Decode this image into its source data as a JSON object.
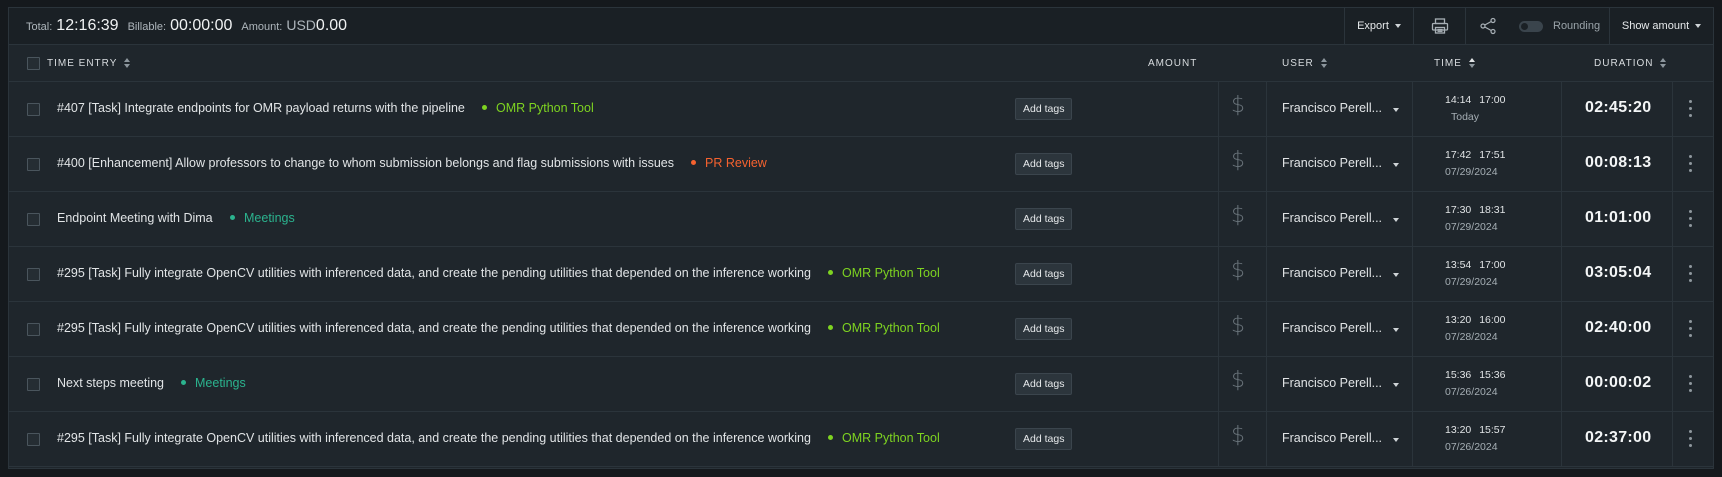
{
  "summary": {
    "total_label": "Total:",
    "total_value": "12:16:39",
    "billable_label": "Billable:",
    "billable_value": "00:00:00",
    "amount_label": "Amount:",
    "amount_currency": "USD",
    "amount_value": "0.00",
    "export_label": "Export",
    "rounding_label": "Rounding",
    "show_amount_label": "Show amount"
  },
  "columns": {
    "time_entry": "TIME ENTRY",
    "amount": "AMOUNT",
    "user": "USER",
    "time": "TIME",
    "duration": "DURATION"
  },
  "add_tags_label": "Add tags",
  "colors": {
    "omr_python_tool": "#7ed321",
    "pr_review": "#f5622f",
    "meetings": "#2bb38e"
  },
  "entries": [
    {
      "description": "#407 [Task] Integrate endpoints for OMR payload returns with the pipeline",
      "project": "OMR Python Tool",
      "project_color": "#7ed321",
      "user": "Francisco Perell...",
      "start": "14:14",
      "end": "17:00",
      "date": "Today",
      "duration": "02:45:20"
    },
    {
      "description": "#400 [Enhancement] Allow professors to change to whom submission belongs and flag submissions with issues",
      "project": "PR Review",
      "project_color": "#f5622f",
      "user": "Francisco Perell...",
      "start": "17:42",
      "end": "17:51",
      "date": "07/29/2024",
      "duration": "00:08:13"
    },
    {
      "description": "Endpoint Meeting with Dima",
      "project": "Meetings",
      "project_color": "#2bb38e",
      "user": "Francisco Perell...",
      "start": "17:30",
      "end": "18:31",
      "date": "07/29/2024",
      "duration": "01:01:00"
    },
    {
      "description": "#295 [Task] Fully integrate OpenCV utilities with inferenced data, and create the pending utilities that depended on the inference working",
      "project": "OMR Python Tool",
      "project_color": "#7ed321",
      "user": "Francisco Perell...",
      "start": "13:54",
      "end": "17:00",
      "date": "07/29/2024",
      "duration": "03:05:04"
    },
    {
      "description": "#295 [Task] Fully integrate OpenCV utilities with inferenced data, and create the pending utilities that depended on the inference working",
      "project": "OMR Python Tool",
      "project_color": "#7ed321",
      "user": "Francisco Perell...",
      "start": "13:20",
      "end": "16:00",
      "date": "07/28/2024",
      "duration": "02:40:00"
    },
    {
      "description": "Next steps meeting",
      "project": "Meetings",
      "project_color": "#2bb38e",
      "user": "Francisco Perell...",
      "start": "15:36",
      "end": "15:36",
      "date": "07/26/2024",
      "duration": "00:00:02"
    },
    {
      "description": "#295 [Task] Fully integrate OpenCV utilities with inferenced data, and create the pending utilities that depended on the inference working",
      "project": "OMR Python Tool",
      "project_color": "#7ed321",
      "user": "Francisco Perell...",
      "start": "13:20",
      "end": "15:57",
      "date": "07/26/2024",
      "duration": "02:37:00"
    }
  ]
}
